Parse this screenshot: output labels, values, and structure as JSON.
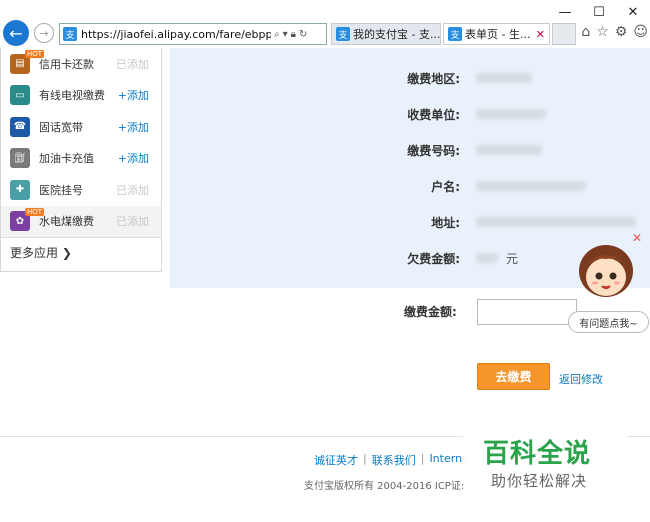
{
  "browser": {
    "url": "https://jiaofei.alipay.com/fare/ebppCh",
    "favicon_char": "支",
    "tabs": [
      {
        "label": "我的支付宝 - 支...",
        "active": false
      },
      {
        "label": "表单页 - 生...",
        "active": true
      }
    ],
    "window_controls": [
      "—",
      "☐",
      "✕"
    ]
  },
  "sidebar": {
    "items": [
      {
        "label": "信用卡还款",
        "action": "已添加",
        "state": "added",
        "icon_name": "credit-card-icon",
        "icon_color": "#b5651d",
        "hot": true,
        "hot_label": "HOT"
      },
      {
        "label": "有线电视缴费",
        "action": "+添加",
        "state": "add",
        "icon_name": "tv-icon",
        "icon_color": "#2b8a8a",
        "hot": false
      },
      {
        "label": "固话宽带",
        "action": "+添加",
        "state": "add",
        "icon_name": "telephone-icon",
        "icon_color": "#1d5aa8",
        "hot": false
      },
      {
        "label": "加油卡充值",
        "action": "+添加",
        "state": "add",
        "icon_name": "fuel-icon",
        "icon_color": "#7a7a7a",
        "hot": false
      },
      {
        "label": "医院挂号",
        "action": "已添加",
        "state": "added",
        "icon_name": "hospital-icon",
        "icon_color": "#4aa0a6",
        "hot": false
      },
      {
        "label": "水电煤缴费",
        "action": "已添加",
        "state": "added",
        "icon_name": "utilities-icon",
        "icon_color": "#7b3fa0",
        "hot": true,
        "hot_label": "HOT",
        "active": true
      }
    ],
    "more_label": "更多应用 ❯"
  },
  "bill_info": {
    "fields": [
      {
        "label": "缴费地区:"
      },
      {
        "label": "收费单位:"
      },
      {
        "label": "缴费号码:"
      },
      {
        "label": "户名:"
      },
      {
        "label": "地址:"
      },
      {
        "label": "欠费金额:",
        "unit": "元"
      }
    ]
  },
  "payment": {
    "amount_label": "缴费金额:",
    "pay_button": "去缴费",
    "back_link": "返回修改"
  },
  "mascot": {
    "bubble_text": "有问题点我~",
    "close": "✕"
  },
  "footer": {
    "links": [
      "诚征英才",
      "联系我们",
      "Interna"
    ],
    "separator": "|",
    "copyright": "支付宝版权所有 2004-2016 ICP证:"
  },
  "watermark": {
    "title": "百科全说",
    "subtitle": "助你轻松解决"
  }
}
